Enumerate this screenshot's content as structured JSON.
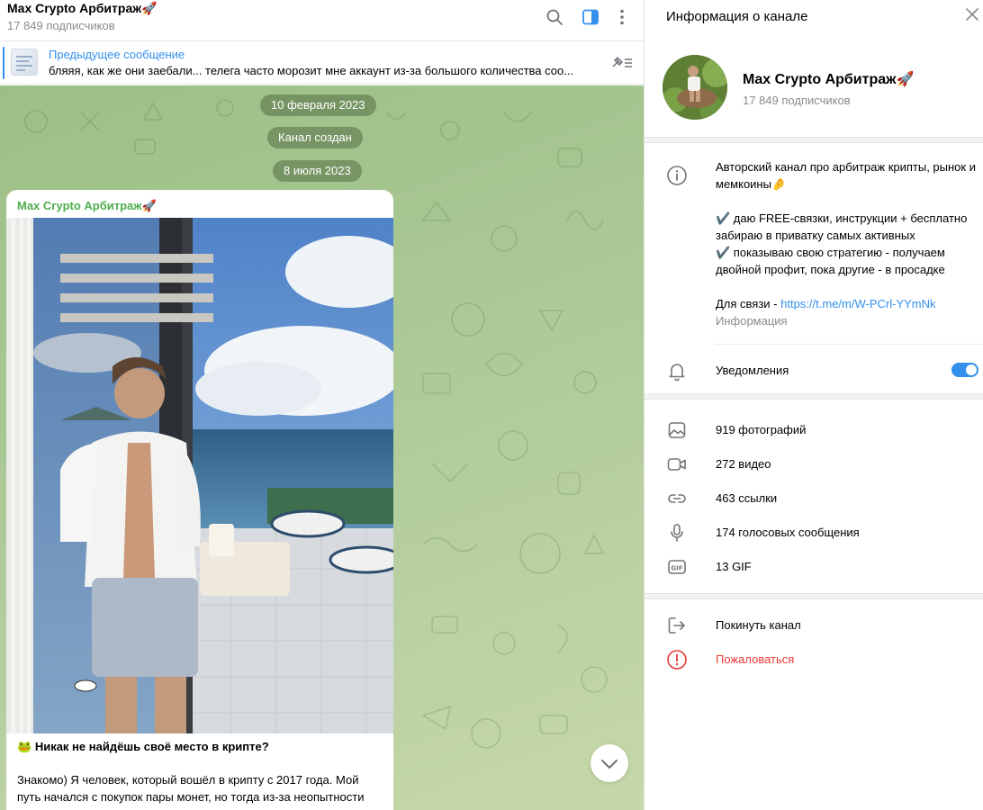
{
  "chat": {
    "title": "Max Crypto Арбитраж🚀",
    "subscribers": "17 849 подписчиков",
    "pinned": {
      "title": "Предыдущее сообщение",
      "text": "бляяя, как же они заебали... телега часто морозит мне аккаунт из-за большого количества соо..."
    },
    "service_pills": [
      "10 февраля 2023",
      "Канал создан",
      "8 июля 2023"
    ],
    "message": {
      "author": "Max Crypto Арбитраж🚀",
      "heading_emoji": "🐸",
      "heading": "Никак не найдёшь своё место в крипте?",
      "body": "Знакомо) Я человек, который вошёл в крипту с 2017 года. Мой путь начался с покупок пары монет, но тогда из-за неопытности"
    }
  },
  "panel": {
    "title": "Информация о канале",
    "channel_name": "Max Crypto Арбитраж🚀",
    "channel_subs": "17 849 подписчиков",
    "about": {
      "line1": "Авторский канал про арбитраж крипты, рынок и мемкоины🤌",
      "line2": "✔️ даю FREE-связки, инструкции + бесплатно забираю в приватку самых активных",
      "line3": "✔️ показываю свою стратегию - получаем двойной профит, пока другие - в просадке",
      "contact_prefix": "Для связи - ",
      "contact_link": "https://t.me/m/W-PCrl-YYmNk",
      "caption": "Информация"
    },
    "notifications_label": "Уведомления",
    "notifications_on": true,
    "media": {
      "photos": "919 фотографий",
      "videos": "272 видео",
      "links": "463 ссылки",
      "voice": "174 голосовых сообщения",
      "gifs": "13 GIF"
    },
    "leave": "Покинуть канал",
    "report": "Пожаловаться"
  },
  "colors": {
    "accent": "#3390ec",
    "author_green": "#4fae4e",
    "danger": "#e53935",
    "chat_bg": "#a8c793"
  },
  "icons": [
    "search-icon",
    "sidebar-toggle-icon",
    "more-icon",
    "pin-list-icon",
    "chevron-down-icon",
    "close-icon",
    "info-icon",
    "bell-icon",
    "photo-icon",
    "video-icon",
    "link-icon",
    "mic-icon",
    "gif-icon",
    "leave-icon",
    "report-icon"
  ]
}
